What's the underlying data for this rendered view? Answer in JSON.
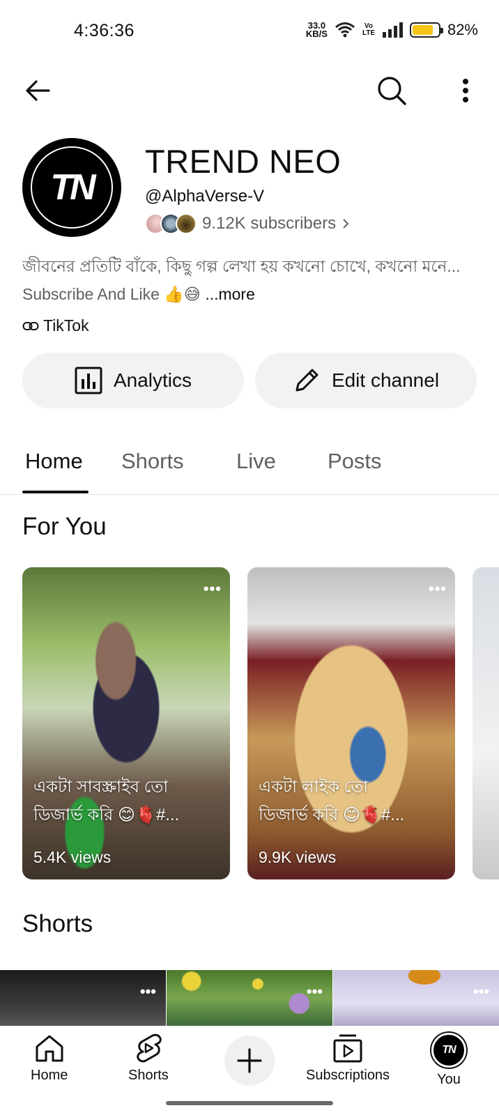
{
  "status_bar": {
    "time": "4:36:36",
    "net_speed_value": "33.0",
    "net_speed_unit": "KB/S",
    "volte_label": "Vo LTE",
    "battery_percent": "82%",
    "battery_level": 0.82
  },
  "channel": {
    "name": "TREND NEO",
    "avatar_text": "TN",
    "handle": "@AlphaVerse-V",
    "subscribers": "9.12K subscribers",
    "description_line1": "জীবনের প্রতিটি বাঁকে, কিছু গল্প লেখা হয় কখনো চোখে, কখনো মনে...",
    "description_line2": "Subscribe And Like 👍😅",
    "more_label": "...more",
    "link_label": "TikTok"
  },
  "actions": {
    "analytics_label": "Analytics",
    "edit_label": "Edit channel"
  },
  "tabs": [
    {
      "label": "Home",
      "active": true
    },
    {
      "label": "Shorts",
      "active": false
    },
    {
      "label": "Live",
      "active": false
    },
    {
      "label": "Posts",
      "active": false
    }
  ],
  "for_you": {
    "title": "For You",
    "cards": [
      {
        "title_line1": "একটা সাবস্ক্রাইব তো",
        "title_line2": "ডিজার্ভ করি 😊🫀#...",
        "views": "5.4K views"
      },
      {
        "title_line1": "একটা লাইক তো",
        "title_line2": "ডিজার্ভ করি 😊🫀#...",
        "views": "9.9K views"
      }
    ]
  },
  "shorts_section": {
    "title": "Shorts"
  },
  "bottom_nav": {
    "home": "Home",
    "shorts": "Shorts",
    "subscriptions": "Subscriptions",
    "you": "You",
    "you_avatar_text": "TN"
  }
}
